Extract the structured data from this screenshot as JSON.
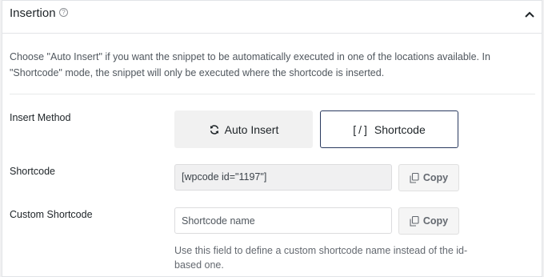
{
  "header": {
    "title": "Insertion",
    "help_glyph": "?",
    "toggle_icon": "chevron-up-icon"
  },
  "description": "Choose \"Auto Insert\" if you want the snippet to be automatically executed in one of the locations available. In \"Shortcode\" mode, the snippet will only be executed where the shortcode is inserted.",
  "insert_method": {
    "label": "Insert Method",
    "options": [
      {
        "label": "Auto Insert",
        "icon": "refresh-icon",
        "selected": false
      },
      {
        "label": "Shortcode",
        "icon": "shortcode-brackets-icon",
        "prefix": "[/]",
        "selected": true
      }
    ]
  },
  "shortcode": {
    "label": "Shortcode",
    "value": "[wpcode id=\"1197\"]",
    "copy_label": "Copy"
  },
  "custom_shortcode": {
    "label": "Custom Shortcode",
    "placeholder": "Shortcode name",
    "copy_label": "Copy",
    "help": "Use this field to define a custom shortcode name instead of the id-based one."
  },
  "colors": {
    "selected_border": "#2a3a5f",
    "panel_border": "#e2e4e7"
  }
}
